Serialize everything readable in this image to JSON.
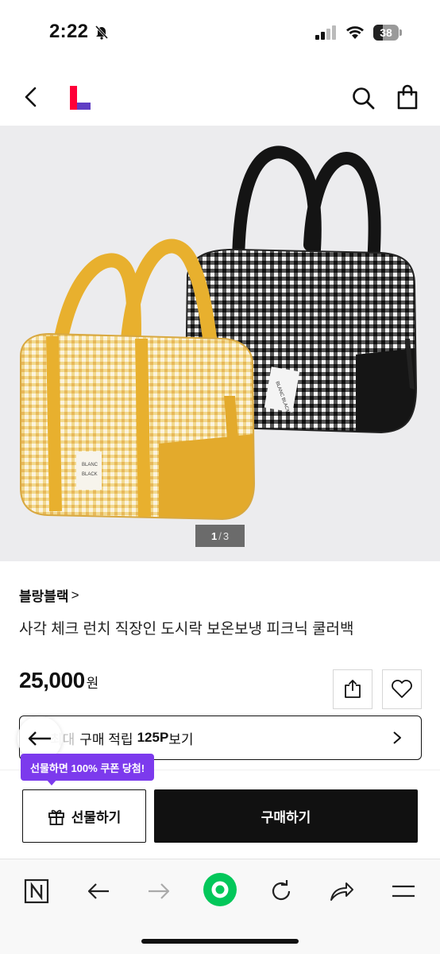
{
  "status_bar": {
    "time": "2:22",
    "battery_level": "38",
    "icons": [
      "bell-off-icon",
      "signal-icon",
      "wifi-icon",
      "battery-icon"
    ]
  },
  "header": {
    "icons": [
      "back-icon",
      "logo",
      "search-icon",
      "cart-icon"
    ]
  },
  "gallery": {
    "current": "1",
    "separator": "/",
    "total": "3"
  },
  "product": {
    "brand": "블랑블랙",
    "brand_chevron": ">",
    "title": "사각 체크 런치 직장인 도시락 보온보냉 피크닉 쿨러백",
    "price": "25,000",
    "price_unit": "원"
  },
  "actions": {
    "share_icon": "share-icon",
    "wish_icon": "heart-icon"
  },
  "points": {
    "prefix": "최대",
    "label": "구매 적립",
    "amount": "125P",
    "suffix": "보기"
  },
  "purchase": {
    "coupon_badge": "선물하면 100% 쿠폰 당첨!",
    "gift_label": "선물하기",
    "buy_label": "구매하기"
  },
  "browser_toolbar": {
    "icons": [
      "naver-n-icon",
      "back-arrow-icon",
      "forward-arrow-icon",
      "green-home-icon",
      "reload-icon",
      "share-arrow-icon",
      "menu-icon"
    ]
  },
  "colors": {
    "accent_purple": "#7c3aed",
    "logo_red": "#ff0038",
    "logo_purple": "#5f3dc4",
    "browser_green": "#03c75a",
    "bag_yellow": "#e8b02e"
  }
}
